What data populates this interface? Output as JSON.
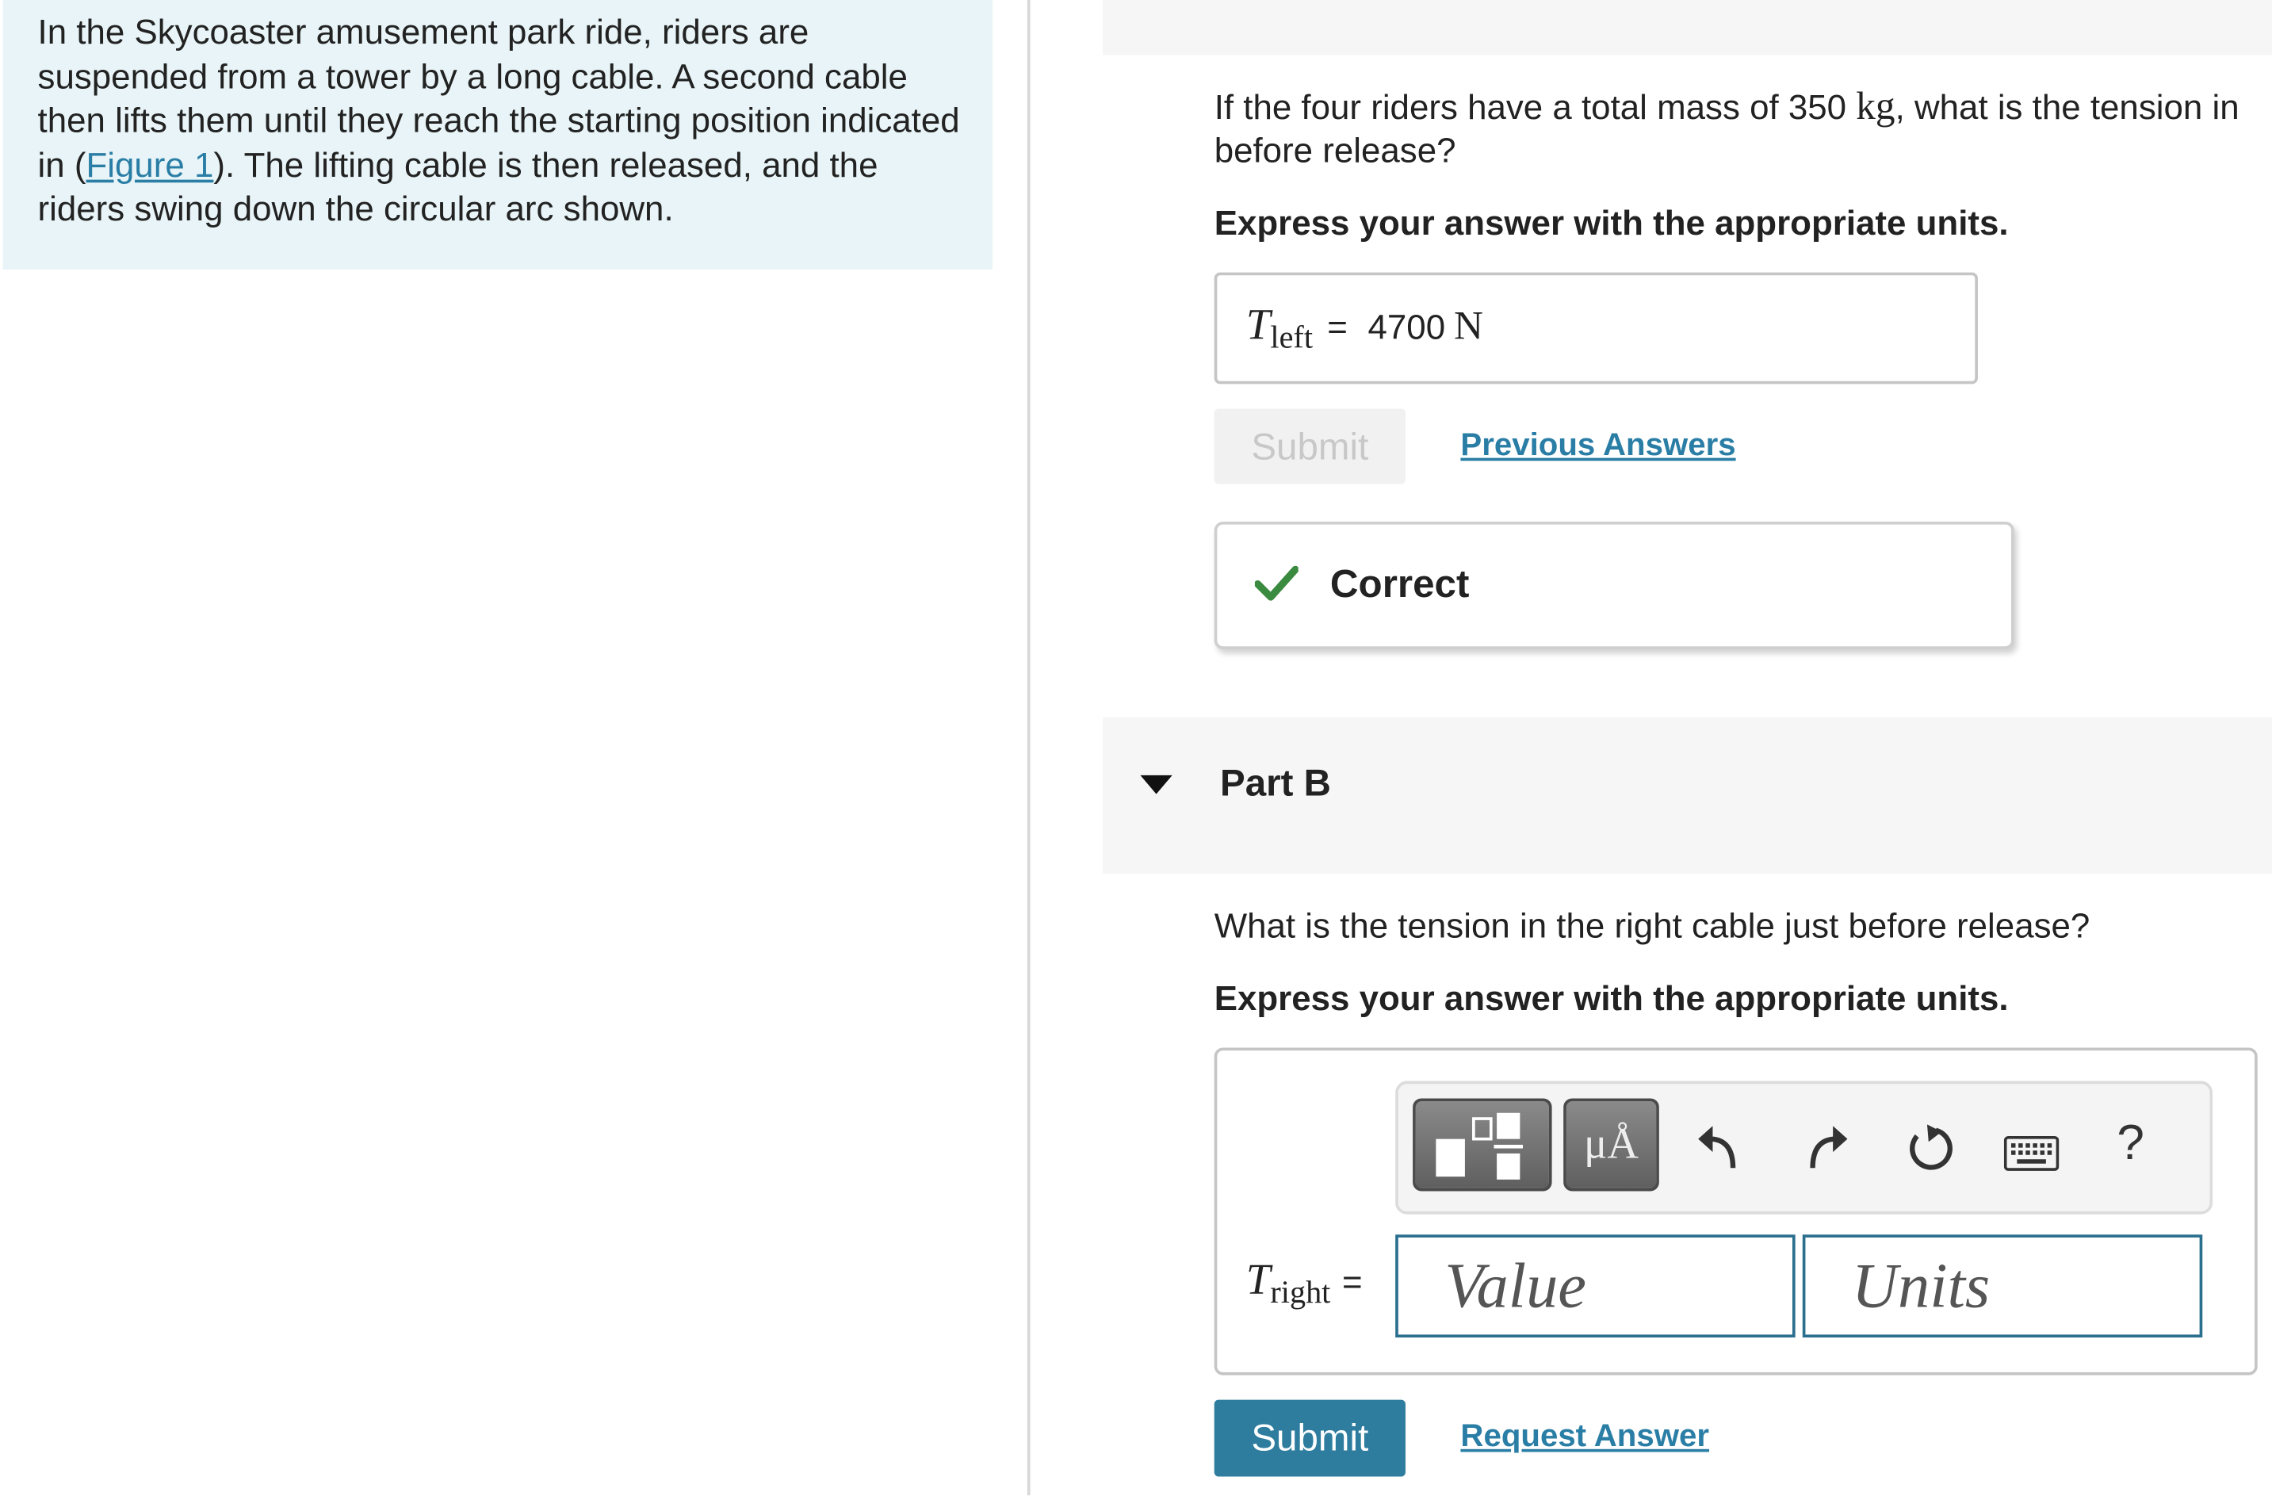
{
  "intro": {
    "text_before_link": "In the Skycoaster amusement park ride, riders are suspended from a tower by a long cable. A second cable then lifts them until they reach the starting position indicated in (",
    "link_text": "Figure 1",
    "text_after_link": "). The lifting cable is then released, and the riders swing down the circular arc shown."
  },
  "part_a": {
    "question_before_unit": "If the four riders have a total mass of 350 ",
    "question_unit": "kg",
    "question_after_unit": ", what is the tension in",
    "question_line2": "before release?",
    "instruction": "Express your answer with the appropriate units.",
    "answer": {
      "variable": "T",
      "subscript": "left",
      "equals": "=",
      "value": "4700",
      "unit": "N"
    },
    "submit_label": "Submit",
    "previous_answers_label": "Previous Answers",
    "feedback": {
      "status": "Correct",
      "icon": "checkmark-icon",
      "color": "#3a8a3f"
    }
  },
  "part_b": {
    "title": "Part B",
    "question": "What is the tension in the right cable just before release?",
    "instruction": "Express your answer with the appropriate units.",
    "toolbar": {
      "buttons": [
        "templates-icon",
        "symbols-icon",
        "undo-icon",
        "redo-icon",
        "reset-icon",
        "keyboard-icon",
        "help-icon"
      ],
      "symbols_label": "μÅ",
      "help_label": "?"
    },
    "variable": "T",
    "subscript": "right",
    "equals": "=",
    "value_placeholder": "Value",
    "units_placeholder": "Units",
    "submit_label": "Submit",
    "request_answer_label": "Request Answer"
  },
  "colors": {
    "accent": "#2e7d9e",
    "link": "#2a7ea6",
    "intro_bg": "#e8f4f7",
    "correct": "#3a8a3f"
  }
}
